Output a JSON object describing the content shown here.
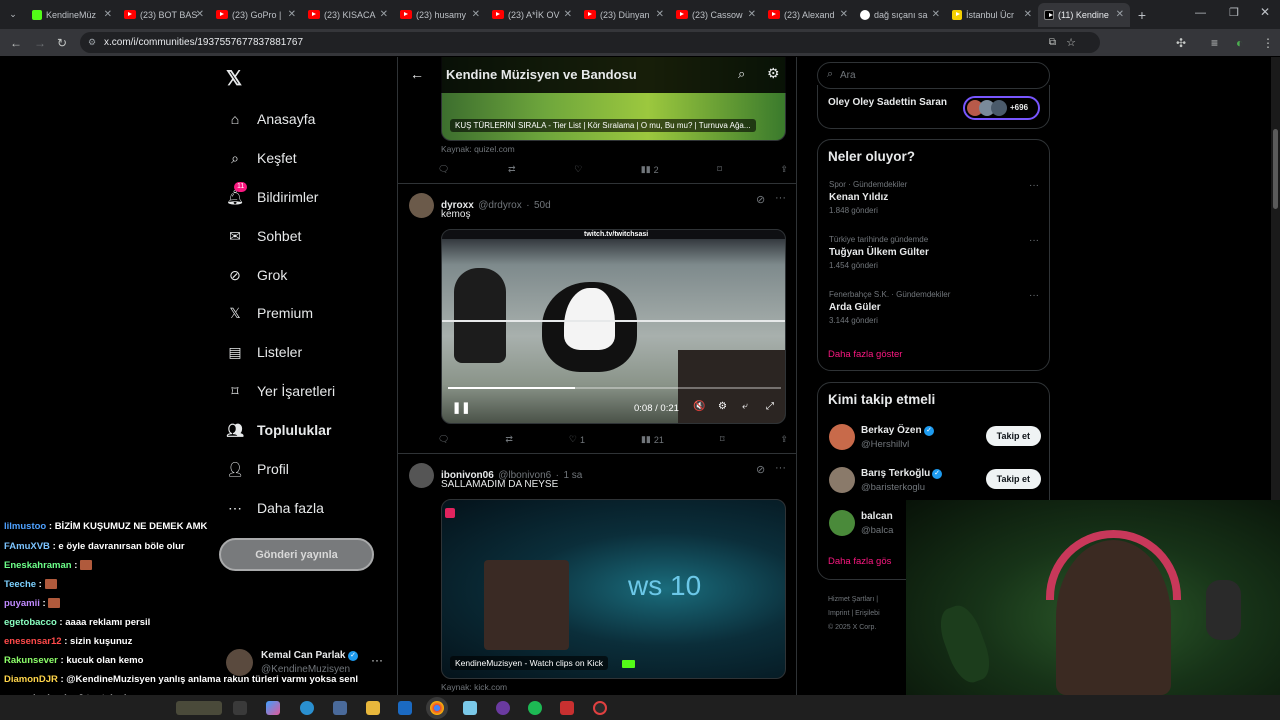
{
  "browser": {
    "tabs": [
      {
        "label": "KendineMüz",
        "kind": "x-green"
      },
      {
        "label": "(23) BOT BAS",
        "kind": "yt"
      },
      {
        "label": "(23) GoPro |",
        "kind": "yt"
      },
      {
        "label": "(23) KISACA",
        "kind": "yt"
      },
      {
        "label": "(23) husamy",
        "kind": "yt"
      },
      {
        "label": "(23) A*İK OV",
        "kind": "yt"
      },
      {
        "label": "(23) Dünyan",
        "kind": "yt"
      },
      {
        "label": "(23) Cassow",
        "kind": "yt"
      },
      {
        "label": "(23) Alexand",
        "kind": "yt"
      },
      {
        "label": "dağ sıçanı sa",
        "kind": "google"
      },
      {
        "label": "İstanbul Ücr",
        "kind": "s"
      },
      {
        "label": "(11) Kendine",
        "kind": "x",
        "active": true
      }
    ],
    "url": "x.com/i/communities/1937557677837881767"
  },
  "nav": {
    "items": [
      {
        "label": "Anasayfa",
        "icon": "home-icon"
      },
      {
        "label": "Keşfet",
        "icon": "search-icon"
      },
      {
        "label": "Bildirimler",
        "icon": "bell-icon",
        "badge": "11"
      },
      {
        "label": "Sohbet",
        "icon": "mail-icon"
      },
      {
        "label": "Grok",
        "icon": "grok-icon"
      },
      {
        "label": "Premium",
        "icon": "x-icon"
      },
      {
        "label": "Listeler",
        "icon": "list-icon"
      },
      {
        "label": "Yer İşaretleri",
        "icon": "bookmark-icon"
      },
      {
        "label": "Topluluklar",
        "icon": "communities-icon"
      },
      {
        "label": "Profil",
        "icon": "profile-icon"
      },
      {
        "label": "Daha fazla",
        "icon": "more-icon"
      }
    ],
    "post_button": "Gönderi yayınla",
    "account": {
      "name": "Kemal Can Parlak",
      "handle": "@KendineMuzisyen"
    }
  },
  "header": {
    "title": "Kendine Müzisyen ve Bandosu"
  },
  "tweets": [
    {
      "card_title": "KUŞ TÜRLERİNİ SIRALA - Tier List | Kör Sıralama | O mu, Bu mu? | Turnuva Ağa...",
      "source": "Kaynak: quizel.com",
      "views": "2"
    },
    {
      "name": "dyroxx",
      "handle": "@drdyrox",
      "time": "50d",
      "text": "kemoş",
      "banner": "twitch.tv/twitchsasi",
      "video_time": "0:08 / 0:21",
      "likes": "1",
      "views": "21"
    },
    {
      "name": "ibonivon06",
      "handle": "@lbonivon6",
      "time": "1 sa",
      "text": "SALLAMADIM DA NEYSE",
      "card_caption": "KendineMuzisyen - Watch clips on Kick",
      "screen_text": "ws 10",
      "source": "Kaynak: kick.com"
    }
  ],
  "right": {
    "search_placeholder": "Ara",
    "pinned_community": {
      "label": "Oley Oley Sadettin Saran",
      "count": "+696"
    },
    "trends_title": "Neler oluyor?",
    "trends": [
      {
        "meta": "Spor · Gündemdekiler",
        "title": "Kenan Yıldız",
        "count": "1.848 gönderi"
      },
      {
        "meta": "Türkiye tarihinde gündemde",
        "title": "Tuğyan Ülkem Gülter",
        "count": "1.454 gönderi"
      },
      {
        "meta": "Fenerbahçe S.K. · Gündemdekiler",
        "title": "Arda Güler",
        "count": "3.144 gönderi"
      }
    ],
    "trends_more": "Daha fazla göster",
    "who_title": "Kimi takip etmeli",
    "who": [
      {
        "name": "Berkay Özen",
        "handle": "@Hershillvl",
        "button": "Takip et"
      },
      {
        "name": "Barış Terkoğlu",
        "handle": "@baristerkoglu",
        "button": "Takip et"
      },
      {
        "name": "balcan",
        "handle": "@balca",
        "button": ""
      }
    ],
    "who_more": "Daha fazla gös",
    "footer": [
      "Hizmet Şartları",
      "Imprint",
      "Erişilebi",
      "© 2025 X Corp."
    ]
  },
  "chat": [
    {
      "user": "lilmustoo",
      "color": "#4ea1ff",
      "msg": "BİZİM KUŞUMUZ NE DEMEK AMK"
    },
    {
      "user": "FAmuXVB",
      "color": "#7cc4ff",
      "msg": "e öyle davranırsan böle olur"
    },
    {
      "user": "Eneskahraman",
      "color": "#6dff8a",
      "msg": ""
    },
    {
      "user": "Teeche",
      "color": "#7cd1ff",
      "msg": ""
    },
    {
      "user": "puyamii",
      "color": "#c08aff",
      "msg": ""
    },
    {
      "user": "egetobacco",
      "color": "#8affc1",
      "msg": "aaaa reklamı persil"
    },
    {
      "user": "enesensar12",
      "color": "#ff4a4a",
      "msg": "sizin kuşunuz"
    },
    {
      "user": "Rakunsever",
      "color": "#8dff6a",
      "msg": "kucuk olan kemo"
    },
    {
      "user": "DiamonDJR",
      "color": "#ffd54a",
      "msg": "@KendineMuzisyen yanlış anlama rakun türleri varmı yoksa senl"
    },
    {
      "user": "",
      "color": "#fff",
      "msg": "normal rakunlar 2 tur tekmi"
    }
  ],
  "colors": {
    "accent": "#1d9bf0",
    "pink": "#f91880",
    "bg": "#000000"
  }
}
